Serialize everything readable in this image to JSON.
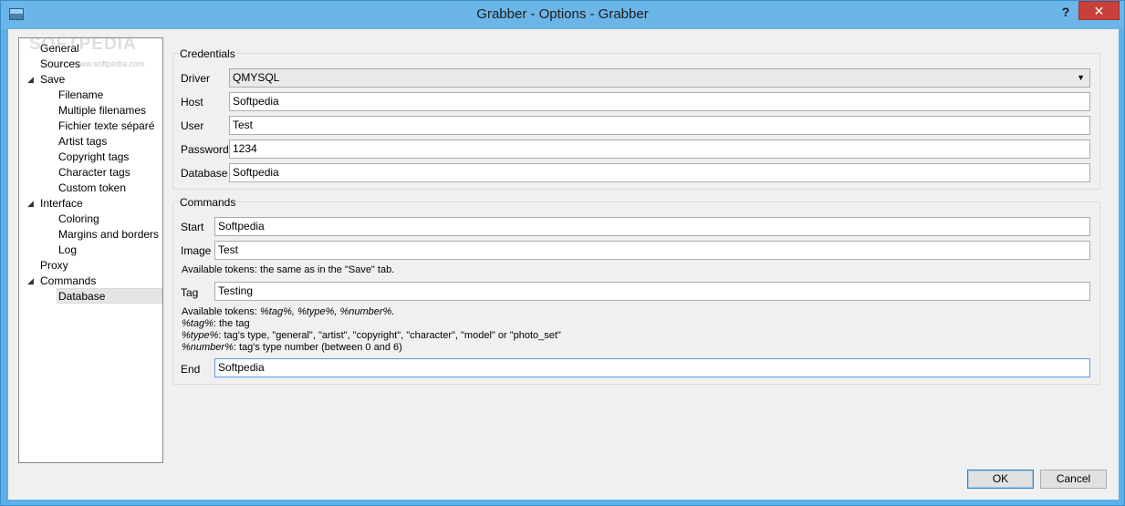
{
  "window": {
    "title": "Grabber - Options - Grabber",
    "help_label": "?",
    "close_label": "✕"
  },
  "watermark": {
    "main": "SOFTPEDIA",
    "sub": "www.softpedia.com"
  },
  "sidebar": {
    "items": [
      {
        "label": "General"
      },
      {
        "label": "Sources"
      },
      {
        "label": "Save"
      },
      {
        "label": "Filename"
      },
      {
        "label": "Multiple filenames"
      },
      {
        "label": "Fichier texte séparé"
      },
      {
        "label": "Artist tags"
      },
      {
        "label": "Copyright tags"
      },
      {
        "label": "Character tags"
      },
      {
        "label": "Custom token"
      },
      {
        "label": "Interface"
      },
      {
        "label": "Coloring"
      },
      {
        "label": "Margins and borders"
      },
      {
        "label": "Log"
      },
      {
        "label": "Proxy"
      },
      {
        "label": "Commands"
      },
      {
        "label": "Database"
      }
    ],
    "selected": "Database"
  },
  "credentials": {
    "title": "Credentials",
    "driver_label": "Driver",
    "driver_value": "QMYSQL",
    "host_label": "Host",
    "host_value": "Softpedia",
    "user_label": "User",
    "user_value": "Test",
    "password_label": "Password",
    "password_value": "1234",
    "database_label": "Database",
    "database_value": "Softpedia"
  },
  "commands": {
    "title": "Commands",
    "start_label": "Start",
    "start_value": "Softpedia",
    "image_label": "Image",
    "image_value": "Test",
    "image_help": "Available tokens: the same as in the \"Save\" tab.",
    "tag_label": "Tag",
    "tag_value": "Testing",
    "tag_help_prefix": "Available tokens: ",
    "tag_help_tokens": "%tag%, %type%, %number%.",
    "tag_help_line2_token": "%tag%",
    "tag_help_line2_text": ": the tag",
    "tag_help_line3_token": "%type%",
    "tag_help_line3_text": ": tag's type, \"general\", \"artist\", \"copyright\", \"character\", \"model\" or \"photo_set\"",
    "tag_help_line4_token": "%number%",
    "tag_help_line4_text": ": tag's type number (between 0 and 6)",
    "end_label": "End",
    "end_value": "Softpedia"
  },
  "buttons": {
    "ok": "OK",
    "cancel": "Cancel"
  }
}
